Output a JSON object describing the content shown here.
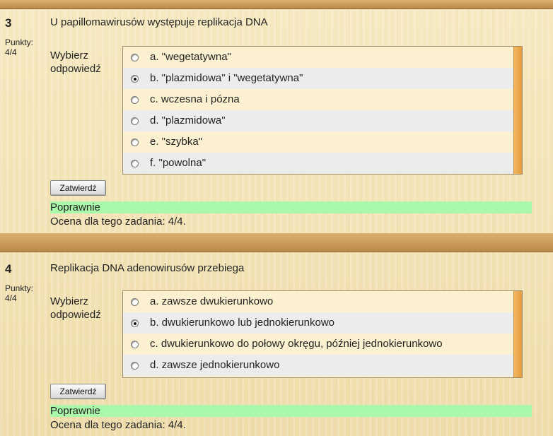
{
  "questions": [
    {
      "number": "3",
      "points_label": "Punkty:",
      "points_value": "4/4",
      "text": "U papillomawirusów występuje replikacja DNA",
      "prompt_line1": "Wybierz",
      "prompt_line2": "odpowiedź",
      "options": [
        {
          "label": "a. \"wegetatywna\"",
          "checked": false
        },
        {
          "label": "b. \"plazmidowa\" i \"wegetatywna\"",
          "checked": true
        },
        {
          "label": "c. wczesna i pózna",
          "checked": false
        },
        {
          "label": "d. \"plazmidowa\"",
          "checked": false
        },
        {
          "label": "e. \"szybka\"",
          "checked": false
        },
        {
          "label": "f. \"powolna\"",
          "checked": false
        }
      ],
      "submit_label": "Zatwierdź",
      "feedback": "Poprawnie",
      "grade": "Ocena dla tego zadania: 4/4."
    },
    {
      "number": "4",
      "points_label": "Punkty:",
      "points_value": "4/4",
      "text": "Replikacja DNA adenowirusów przebiega",
      "prompt_line1": "Wybierz",
      "prompt_line2": "odpowiedź",
      "options": [
        {
          "label": "a. zawsze dwukierunkowo",
          "checked": false
        },
        {
          "label": "b. dwukierunkowo lub jednokierunkowo",
          "checked": true
        },
        {
          "label": "c. dwukierunkowo do połowy okręgu, później jednokierunkowo",
          "checked": false
        },
        {
          "label": "d. zawsze jednokierunkowo",
          "checked": false
        }
      ],
      "submit_label": "Zatwierdź",
      "feedback": "Poprawnie",
      "grade": "Ocena dla tego zadania: 4/4."
    }
  ],
  "colors": {
    "feedback_bg": "#aaf8aa",
    "divider": "#c99a55",
    "scrollbar": "#e49a3c"
  }
}
